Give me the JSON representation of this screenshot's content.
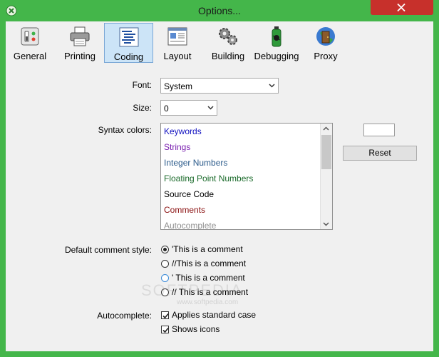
{
  "window": {
    "title": "Options...",
    "frame_color": "#44b64a",
    "close_color": "#c7302b"
  },
  "toolbar": {
    "tabs": [
      {
        "label": "General",
        "icon": "switches-icon"
      },
      {
        "label": "Printing",
        "icon": "printer-icon"
      },
      {
        "label": "Coding",
        "icon": "code-document-icon",
        "active": true
      },
      {
        "label": "Layout",
        "icon": "layout-window-icon"
      },
      {
        "label": "Building",
        "icon": "gears-icon"
      },
      {
        "label": "Debugging",
        "icon": "bug-spray-icon"
      },
      {
        "label": "Proxy",
        "icon": "globe-door-icon"
      }
    ]
  },
  "font": {
    "label": "Font:",
    "value": "System"
  },
  "size": {
    "label": "Size:",
    "value": "0"
  },
  "syntax": {
    "label": "Syntax colors:",
    "items": [
      {
        "text": "Keywords",
        "color": "#1010c0"
      },
      {
        "text": "Strings",
        "color": "#7a20b0"
      },
      {
        "text": "Integer Numbers",
        "color": "#2a5a8a"
      },
      {
        "text": "Floating Point Numbers",
        "color": "#1a6a2a"
      },
      {
        "text": "Source Code",
        "color": "#000000"
      },
      {
        "text": "Comments",
        "color": "#8a1010"
      },
      {
        "text": "Autocomplete",
        "color": "#909090"
      }
    ],
    "reset_label": "Reset"
  },
  "comment_style": {
    "label": "Default comment style:",
    "options": [
      {
        "text": "'This is a comment",
        "checked": true
      },
      {
        "text": "//This is a comment",
        "checked": false
      },
      {
        "text": "' This is a comment",
        "checked": false
      },
      {
        "text": "// This is a comment",
        "checked": false
      }
    ]
  },
  "autocomplete": {
    "label": "Autocomplete:",
    "options": [
      {
        "text": "Applies standard case",
        "checked": true
      },
      {
        "text": "Shows icons",
        "checked": true
      }
    ]
  },
  "watermark": {
    "text": "SOFTPEDIA",
    "sub": "www.softpedia.com"
  }
}
